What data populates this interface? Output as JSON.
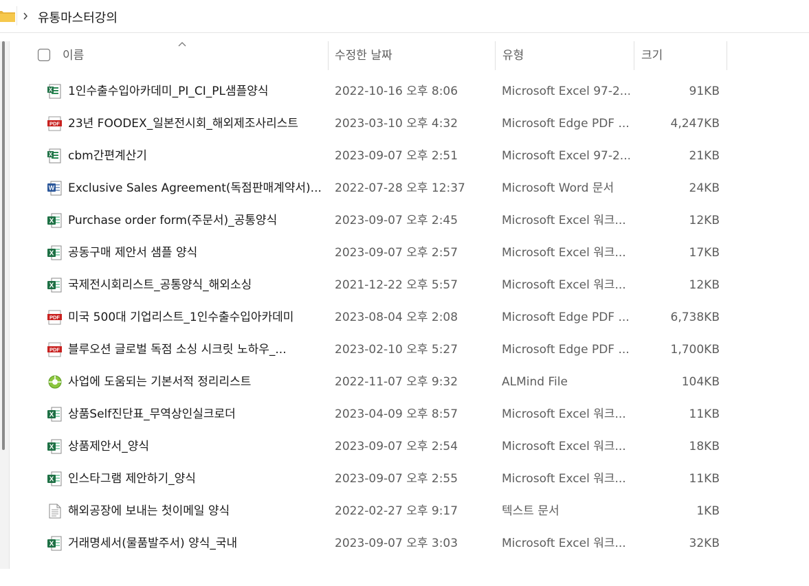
{
  "breadcrumb": {
    "current": "유통마스터강의"
  },
  "columns": {
    "name": "이름",
    "modified": "수정한 날짜",
    "type": "유형",
    "size": "크기"
  },
  "files": [
    {
      "name": "1인수출수입아카데미_PI_CI_PL샘플양식",
      "modified": "2022-10-16 오후 8:06",
      "type": "Microsoft Excel 97-2...",
      "size": "91KB",
      "icon": "excel-legacy-icon"
    },
    {
      "name": "23년 FOODEX_일본전시회_해외제조사리스트",
      "modified": "2023-03-10 오후 4:32",
      "type": "Microsoft Edge PDF ...",
      "size": "4,247KB",
      "icon": "pdf-icon"
    },
    {
      "name": "cbm간편계산기",
      "modified": "2023-09-07 오후 2:51",
      "type": "Microsoft Excel 97-2...",
      "size": "21KB",
      "icon": "excel-legacy-icon"
    },
    {
      "name": "Exclusive Sales Agreement(독점판매계약서)...",
      "modified": "2022-07-28 오후 12:37",
      "type": "Microsoft Word 문서",
      "size": "24KB",
      "icon": "word-icon"
    },
    {
      "name": "Purchase order form(주문서)_공통양식",
      "modified": "2023-09-07 오후 2:45",
      "type": "Microsoft Excel 워크...",
      "size": "12KB",
      "icon": "excel-icon"
    },
    {
      "name": "공동구매 제안서 샘플 양식",
      "modified": "2023-09-07 오후 2:57",
      "type": "Microsoft Excel 워크...",
      "size": "17KB",
      "icon": "excel-icon"
    },
    {
      "name": "국제전시회리스트_공통양식_해외소싱",
      "modified": "2021-12-22 오후 5:57",
      "type": "Microsoft Excel 워크...",
      "size": "12KB",
      "icon": "excel-icon"
    },
    {
      "name": "미국 500대 기업리스트_1인수출수입아카데미",
      "modified": "2023-08-04 오후 2:08",
      "type": "Microsoft Edge PDF ...",
      "size": "6,738KB",
      "icon": "pdf-icon"
    },
    {
      "name": "블루오션 글로벌 독점 소싱 시크릿 노하우_...",
      "modified": "2023-02-10 오후 5:27",
      "type": "Microsoft Edge PDF ...",
      "size": "1,700KB",
      "icon": "pdf-icon"
    },
    {
      "name": "사업에 도움되는 기본서적 정리리스트",
      "modified": "2022-11-07 오후 9:32",
      "type": "ALMind File",
      "size": "104KB",
      "icon": "almind-icon"
    },
    {
      "name": "상품Self진단표_무역상인실크로더",
      "modified": "2023-04-09 오후 8:57",
      "type": "Microsoft Excel 워크...",
      "size": "11KB",
      "icon": "excel-icon"
    },
    {
      "name": "상품제안서_양식",
      "modified": "2023-09-07 오후 2:54",
      "type": "Microsoft Excel 워크...",
      "size": "18KB",
      "icon": "excel-icon"
    },
    {
      "name": "인스타그램 제안하기_양식",
      "modified": "2023-09-07 오후 2:55",
      "type": "Microsoft Excel 워크...",
      "size": "11KB",
      "icon": "excel-icon"
    },
    {
      "name": "해외공장에 보내는 첫이메일 양식",
      "modified": "2022-02-27 오후 9:17",
      "type": "텍스트 문서",
      "size": "1KB",
      "icon": "text-file-icon"
    },
    {
      "name": "거래명세서(물품발주서) 양식_국내",
      "modified": "2023-09-07 오후 3:03",
      "type": "Microsoft Excel 워크...",
      "size": "32KB",
      "icon": "excel-icon"
    }
  ]
}
